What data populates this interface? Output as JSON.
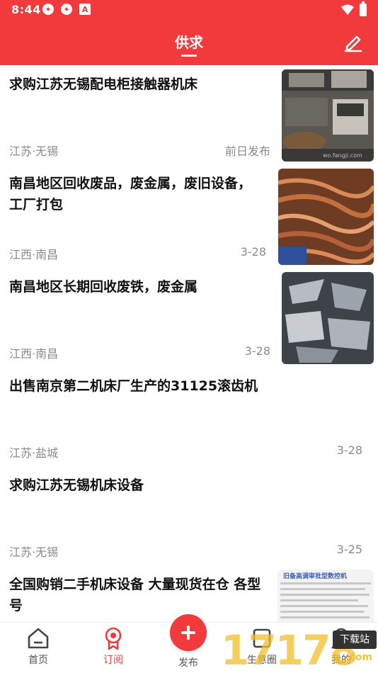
{
  "status_bar": {
    "time": "8:44",
    "notif_icons": [
      "app-icon",
      "app-icon",
      "app-icon"
    ]
  },
  "header": {
    "title": "供求",
    "edit_icon": "edit-pencil-icon"
  },
  "feed": [
    {
      "title": "求购江苏无锡配电柜接触器机床",
      "location": "江苏·无锡",
      "time": "前日发布",
      "thumb": "machine-workshop-photo",
      "thumb_watermark": "wo.fangji.com"
    },
    {
      "title": "南昌地区回收废品，废金属，废旧设备，工厂打包",
      "location": "江西·南昌",
      "time": "3-28",
      "thumb": "copper-wire-photo"
    },
    {
      "title": "南昌地区长期回收废铁，废金属",
      "location": "江西·南昌",
      "time": "3-28",
      "thumb": "scrap-iron-photo"
    },
    {
      "title": "出售南京第二机床厂生产的31125滚齿机",
      "location": "江苏·盐城",
      "time": "3-28"
    },
    {
      "title": "求购江苏无锡机床设备",
      "location": "江苏·无锡",
      "time": "3-25"
    },
    {
      "title": "全国购销二手机床设备 大量现货在仓 各型号",
      "thumb": "document-list-photo",
      "thumb_heading": "旧备高调审批型数控机"
    }
  ],
  "bottom_nav": {
    "items": [
      {
        "label": "首页",
        "icon": "home-icon"
      },
      {
        "label": "订阅",
        "icon": "badge-icon"
      },
      {
        "label": "发布",
        "icon": "plus-icon"
      },
      {
        "label": "生意圈",
        "icon": "square-icon"
      },
      {
        "label": "我的",
        "icon": "user-icon"
      }
    ]
  },
  "watermark": {
    "number": "17178",
    "badge": "下载站",
    "site": "com"
  },
  "colors": {
    "brand_red": "#f23a3c",
    "muted_text": "#8a8a8a"
  }
}
